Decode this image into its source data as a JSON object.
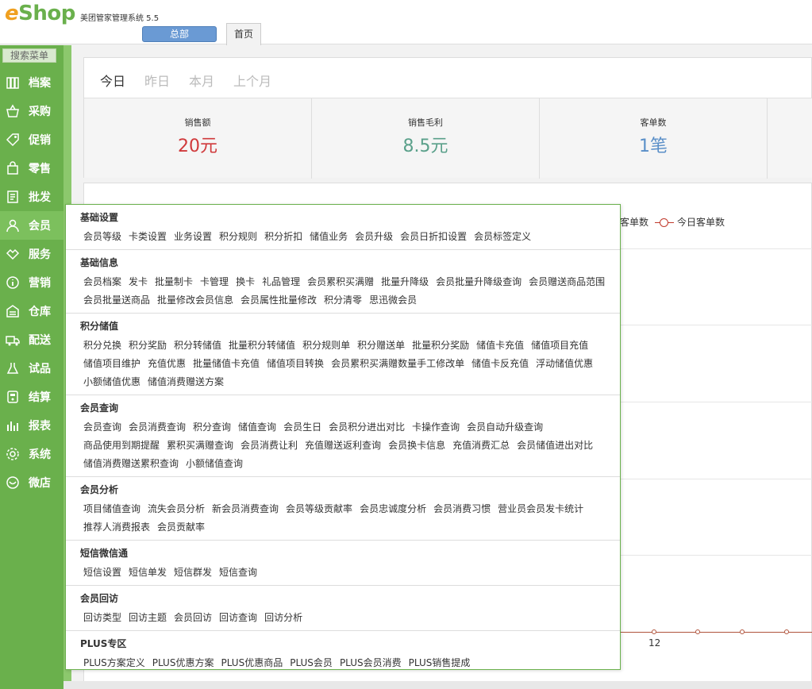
{
  "app": {
    "logo_e": "e",
    "logo_rest": "Shop",
    "subtitle": "美团管家管理系统 5.5",
    "store_button": "总部",
    "home_tab": "首页"
  },
  "sidebar": {
    "search_label": "搜索菜单",
    "items": [
      {
        "label": "档案",
        "icon": "archive-icon"
      },
      {
        "label": "采购",
        "icon": "basket-icon"
      },
      {
        "label": "促销",
        "icon": "tag-icon"
      },
      {
        "label": "零售",
        "icon": "bag-icon"
      },
      {
        "label": "批发",
        "icon": "receipt-icon"
      },
      {
        "label": "会员",
        "icon": "user-icon",
        "active": true
      },
      {
        "label": "服务",
        "icon": "handshake-icon"
      },
      {
        "label": "营销",
        "icon": "info-icon"
      },
      {
        "label": "仓库",
        "icon": "warehouse-icon"
      },
      {
        "label": "配送",
        "icon": "truck-icon"
      },
      {
        "label": "试品",
        "icon": "flask-icon"
      },
      {
        "label": "结算",
        "icon": "calculator-icon"
      },
      {
        "label": "报表",
        "icon": "bar-chart-icon"
      },
      {
        "label": "系统",
        "icon": "gear-icon"
      },
      {
        "label": "微店",
        "icon": "shop-icon"
      }
    ]
  },
  "dashboard": {
    "periods": [
      "今日",
      "昨日",
      "本月",
      "上个月"
    ],
    "active_period": "今日",
    "stats": [
      {
        "label": "销售额",
        "value": "20元",
        "color": "#d0393b"
      },
      {
        "label": "销售毛利",
        "value": "8.5元",
        "color": "#5aa08a"
      },
      {
        "label": "客单数",
        "value": "1笔",
        "color": "#5a8fc8"
      }
    ],
    "legend": {
      "partial": "客单数",
      "series": "今日客单数"
    },
    "x_tick": "12"
  },
  "colors": {
    "sidebar": "#6ab04c",
    "sidebar_active": "#7cc05d",
    "accent_blue": "#6a9ad4"
  },
  "member_menu": {
    "sections": [
      {
        "title": "基础设置",
        "links": [
          "会员等级",
          "卡类设置",
          "业务设置",
          "积分规则",
          "积分折扣",
          "储值业务",
          "会员升级",
          "会员日折扣设置",
          "会员标签定义"
        ]
      },
      {
        "title": "基础信息",
        "links": [
          "会员档案",
          "发卡",
          "批量制卡",
          "卡管理",
          "换卡",
          "礼品管理",
          "会员累积买满赠",
          "批量升降级",
          "会员批量升降级查询",
          "会员赠送商品范围",
          "会员批量送商品",
          "批量修改会员信息",
          "会员属性批量修改",
          "积分清零",
          "思迅微会员"
        ]
      },
      {
        "title": "积分储值",
        "links": [
          "积分兑换",
          "积分奖励",
          "积分转储值",
          "批量积分转储值",
          "积分规则单",
          "积分赠送单",
          "批量积分奖励",
          "储值卡充值",
          "储值项目充值",
          "储值项目维护",
          "充值优惠",
          "批量储值卡充值",
          "储值项目转换",
          "会员累积买满赠数量手工修改单",
          "储值卡反充值",
          "浮动储值优惠",
          "小额储值优惠",
          "储值消费赠送方案"
        ]
      },
      {
        "title": "会员查询",
        "links": [
          "会员查询",
          "会员消费查询",
          "积分查询",
          "储值查询",
          "会员生日",
          "会员积分进出对比",
          "卡操作查询",
          "会员自动升级查询",
          "商品使用到期提醒",
          "累积买满赠查询",
          "会员消费让利",
          "充值赠送返利查询",
          "会员换卡信息",
          "充值消费汇总",
          "会员储值进出对比",
          "储值消费赠送累积查询",
          "小额储值查询"
        ]
      },
      {
        "title": "会员分析",
        "links": [
          "项目储值查询",
          "流失会员分析",
          "新会员消费查询",
          "会员等级贡献率",
          "会员忠诚度分析",
          "会员消费习惯",
          "营业员会员发卡统计",
          "推荐人消费报表",
          "会员贡献率"
        ]
      },
      {
        "title": "短信微信通",
        "links": [
          "短信设置",
          "短信单发",
          "短信群发",
          "短信查询"
        ]
      },
      {
        "title": "会员回访",
        "links": [
          "回访类型",
          "回访主题",
          "会员回访",
          "回访查询",
          "回访分析"
        ]
      },
      {
        "title": "PLUS专区",
        "links": [
          "PLUS方案定义",
          "PLUS优惠方案",
          "PLUS优惠商品",
          "PLUS会员",
          "PLUS会员消费",
          "PLUS销售提成"
        ]
      }
    ]
  }
}
